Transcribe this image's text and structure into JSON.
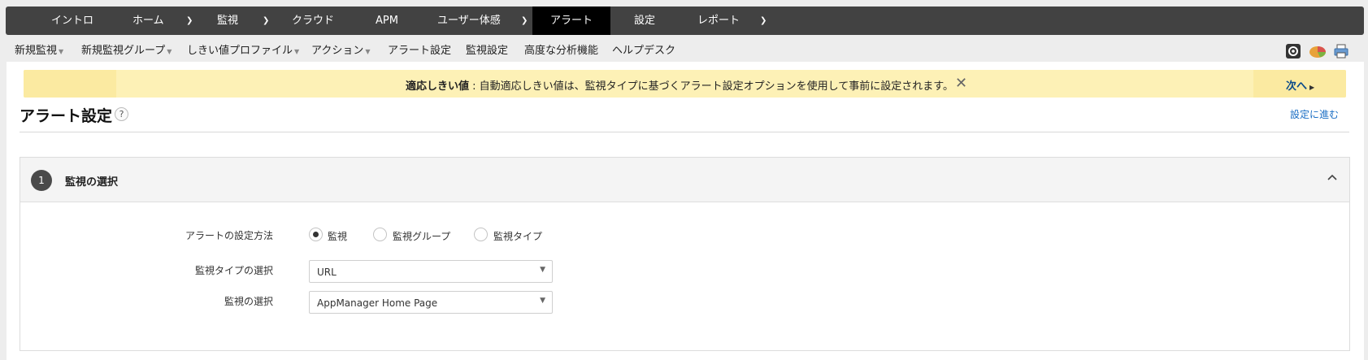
{
  "top_nav": {
    "items": [
      {
        "label": "イントロ"
      },
      {
        "label": "ホーム"
      },
      {
        "label": "監視"
      },
      {
        "label": "クラウド"
      },
      {
        "label": "APM"
      },
      {
        "label": "ユーザー体感"
      },
      {
        "label": "アラート",
        "active": true
      },
      {
        "label": "設定"
      },
      {
        "label": "レポート"
      }
    ]
  },
  "sub_nav": {
    "items": [
      {
        "label": "新規監視",
        "has_caret": true
      },
      {
        "label": "新規監視グループ",
        "has_caret": true
      },
      {
        "label": "しきい値プロファイル",
        "has_caret": true
      },
      {
        "label": "アクション",
        "has_caret": true
      },
      {
        "label": "アラート設定",
        "has_caret": false
      },
      {
        "label": "監視設定",
        "has_caret": false
      },
      {
        "label": "高度な分析機能",
        "has_caret": false
      },
      {
        "label": "ヘルプデスク",
        "has_caret": false
      }
    ],
    "tool_icons": [
      "settings-icon",
      "pie-chart-icon",
      "printer-icon"
    ]
  },
  "banner": {
    "title": "適応しきい値",
    "separator": " : ",
    "text": "自動適応しきい値は、監視タイプに基づくアラート設定オプションを使用して事前に設定されます。",
    "next_label": "次へ"
  },
  "page": {
    "title": "アラート設定",
    "help": "?",
    "goto_link": "設定に進む"
  },
  "section": {
    "step": "1",
    "title": "監視の選択",
    "method_label": "アラートの設定方法",
    "radio_options": [
      {
        "label": "監視",
        "checked": true
      },
      {
        "label": "監視グループ",
        "checked": false
      },
      {
        "label": "監視タイプ",
        "checked": false
      }
    ],
    "type_label": "監視タイプの選択",
    "type_value": "URL",
    "monitor_label": "監視の選択",
    "monitor_value": "AppManager Home Page"
  },
  "colors": {
    "topnav_bg": "#424242",
    "topnav_active": "#000000",
    "banner_bg": "#fdf1b6",
    "link": "#1a6ec4"
  }
}
